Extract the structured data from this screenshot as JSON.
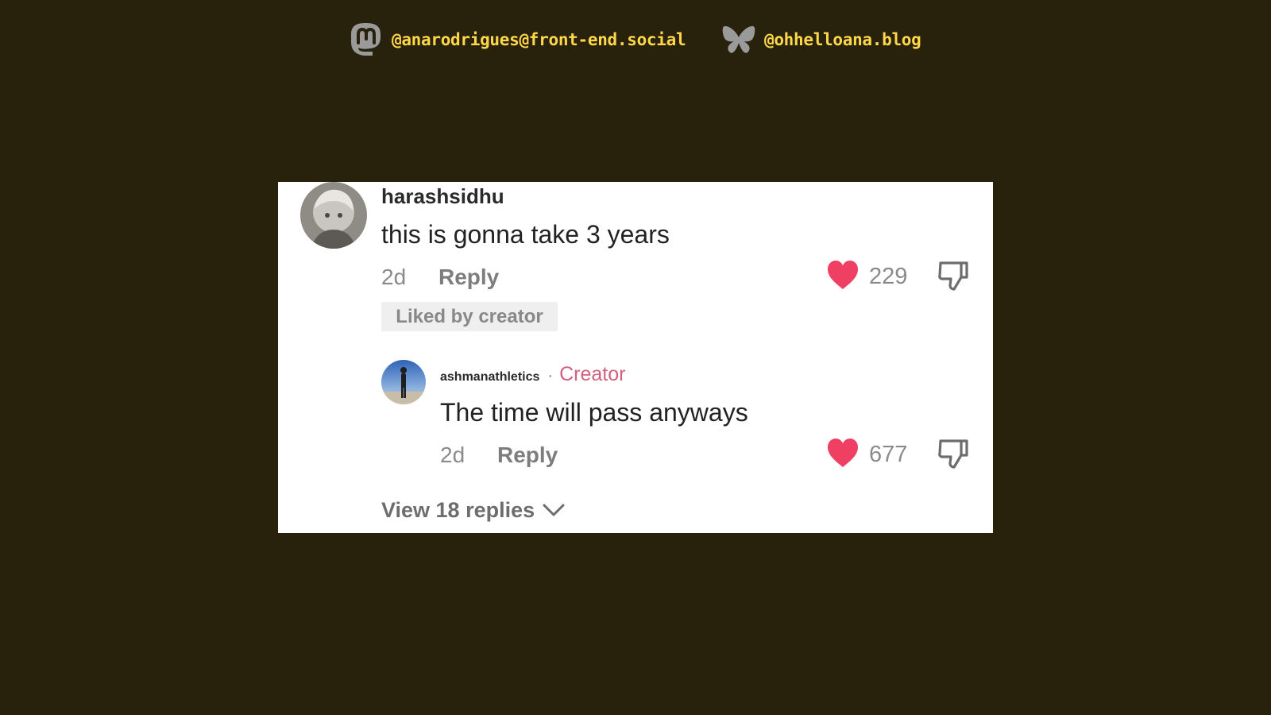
{
  "header": {
    "mastodon": {
      "icon": "mastodon-icon",
      "handle": "@anarodrigues@front-end.social"
    },
    "bluesky": {
      "icon": "bluesky-butterfly-icon",
      "handle": "@ohhelloana.blog"
    }
  },
  "comment": {
    "username": "harashsidhu",
    "text": "this is gonna take 3 years",
    "time": "2d",
    "reply_label": "Reply",
    "likes": "229",
    "liked_badge": "Liked by creator"
  },
  "reply": {
    "username": "ashmanathletics",
    "separator": "·",
    "badge": "Creator",
    "text": "The time will pass anyways",
    "time": "2d",
    "reply_label": "Reply",
    "likes": "677"
  },
  "view_replies": "View 18 replies",
  "colors": {
    "background": "#28210c",
    "handle_text": "#ffd84a",
    "heart": "#ef3f62",
    "creator_badge": "#d2607e"
  }
}
